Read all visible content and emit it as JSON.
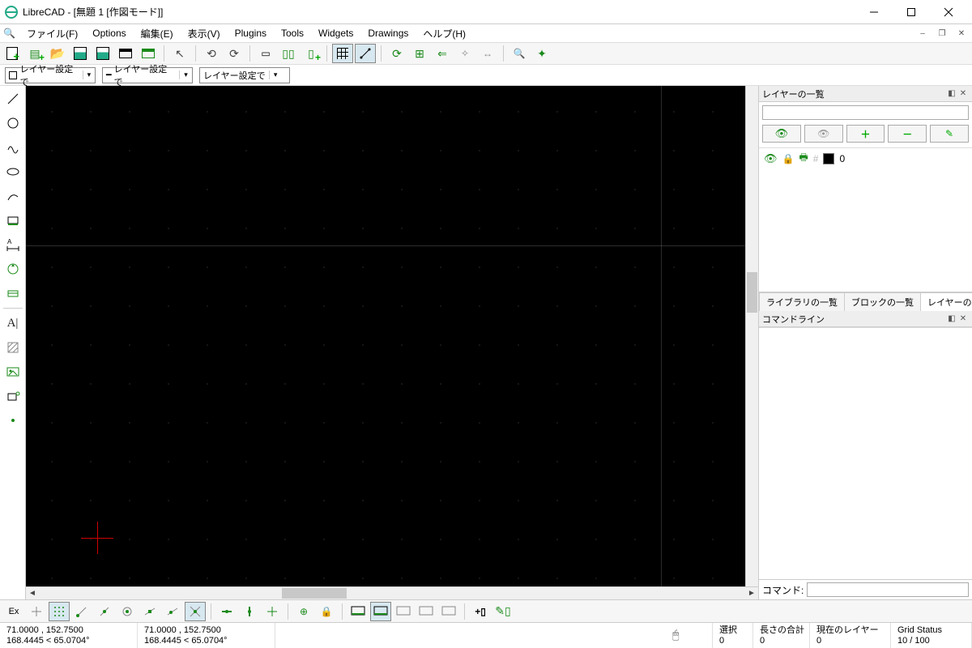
{
  "title": "LibreCAD - [無題 1 [作図モード]]",
  "menu": {
    "file": "ファイル(F)",
    "options": "Options",
    "edit": "編集(E)",
    "view": "表示(V)",
    "plugins": "Plugins",
    "tools": "Tools",
    "widgets": "Widgets",
    "drawings": "Drawings",
    "help": "ヘルプ(H)"
  },
  "combos": {
    "layer": "レイヤー設定で",
    "linetype": "レイヤー設定で",
    "lineweight": "レイヤー設定で"
  },
  "panels": {
    "layers_title": "レイヤーの一覧",
    "cmd_title": "コマンドライン",
    "tab_library": "ライブラリの一覧",
    "tab_blocks": "ブロックの一覧",
    "tab_layers": "レイヤーの一覧"
  },
  "layers": [
    {
      "name": "0"
    }
  ],
  "cmd_label": "コマンド:",
  "status": {
    "coord1a": "71.0000 , 152.7500",
    "coord1b": "168.4445 < 65.0704°",
    "coord2a": "71.0000 , 152.7500",
    "coord2b": "168.4445 < 65.0704°",
    "sel_label": "選択",
    "sel_val": "0",
    "len_label": "長さの合計",
    "len_val": "0",
    "cur_layer_label": "現在のレイヤー",
    "cur_layer_val": "0",
    "grid_label": "Grid Status",
    "grid_val": "10 / 100"
  },
  "snap_ex": "Ex"
}
